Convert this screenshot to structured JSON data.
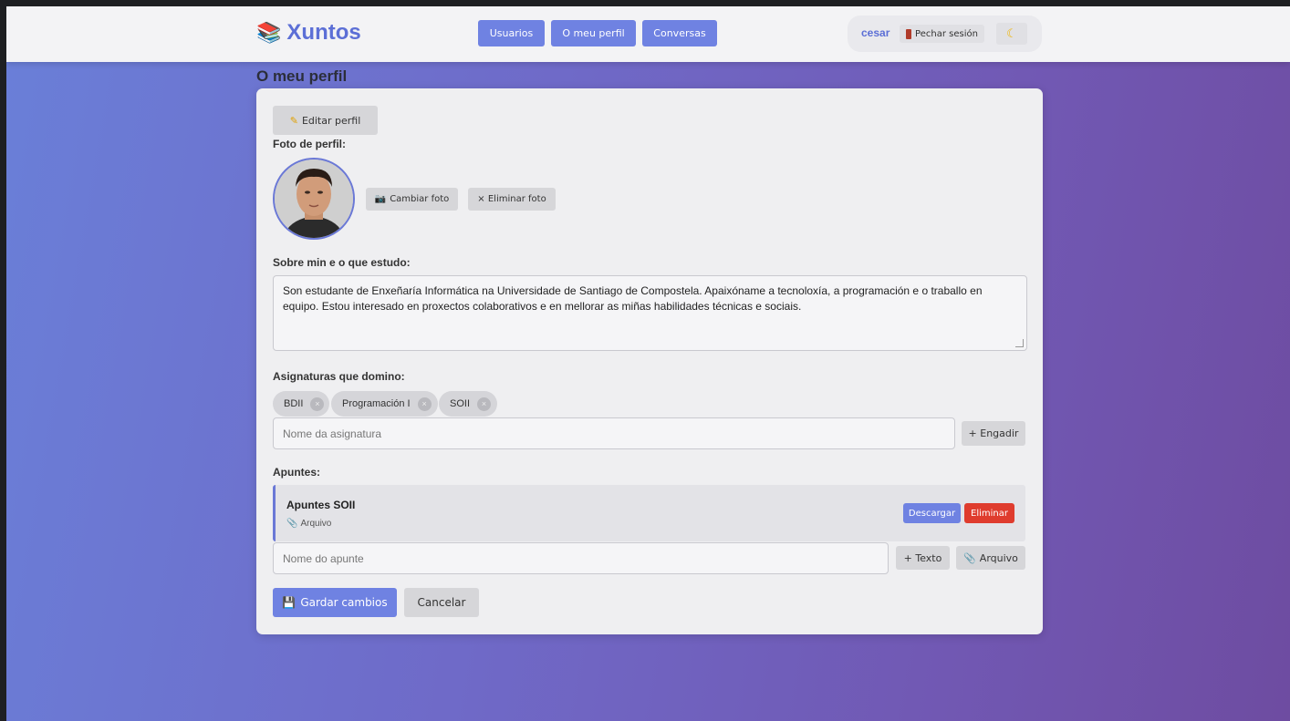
{
  "header": {
    "brand": "Xuntos",
    "brand_icon": "books-icon",
    "nav": [
      "Usuarios",
      "O meu perfil",
      "Conversas"
    ],
    "username": "cesar",
    "logout_label": "Pechar sesión",
    "theme_icon": "moon-icon"
  },
  "page": {
    "title": "O meu perfil"
  },
  "profile": {
    "edit_button": "Editar perfil",
    "photo_label": "Foto de perfil:",
    "change_photo": "Cambiar foto",
    "delete_photo": "× Eliminar foto",
    "about_label": "Sobre min e o que estudo:",
    "about_text": "Son estudante de Enxeñaría Informática na Universidade de Santiago de Compostela. Apaixóname a tecnoloxía, a programación e o traballo en equipo. Estou interesado en proxectos colaborativos e en mellorar as miñas habilidades técnicas e sociais.",
    "subjects_label": "Asignaturas que domino:",
    "subjects": [
      "BDII",
      "Programación I",
      "SOII"
    ],
    "subject_placeholder": "Nome da asignatura",
    "add_subject": "+ Engadir",
    "notes_label": "Apuntes:",
    "notes": [
      {
        "title": "Apuntes SOII",
        "type": "Arquivo",
        "download": "Descargar",
        "delete": "Eliminar"
      }
    ],
    "note_placeholder": "Nome do apunte",
    "add_text": "+ Texto",
    "add_file": "Arquivo",
    "save": "Gardar cambios",
    "cancel": "Cancelar"
  },
  "colors": {
    "accent": "#6f82e2",
    "brand": "#5c6fd6",
    "danger": "#df3c2e"
  }
}
